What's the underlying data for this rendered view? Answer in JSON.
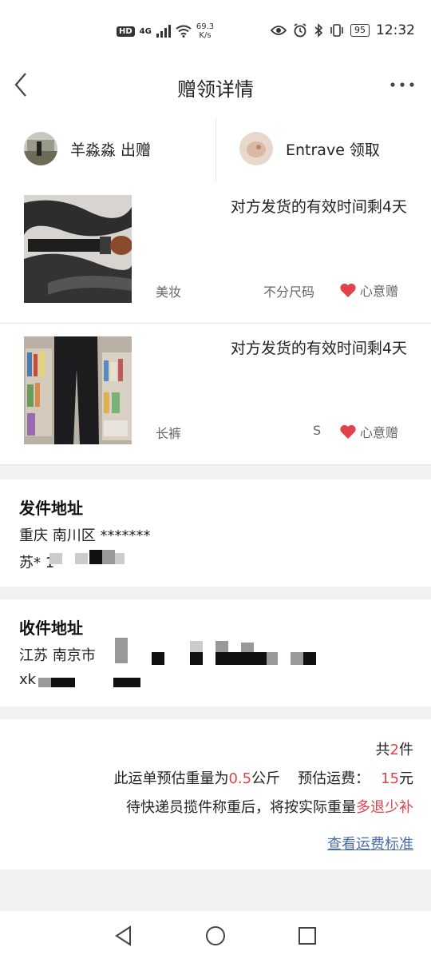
{
  "status_bar": {
    "hd": "HD",
    "network": "4G",
    "speed_value": "69.3",
    "speed_unit": "K/s",
    "battery": "95",
    "time": "12:32"
  },
  "nav": {
    "title": "赠领详情"
  },
  "parties": {
    "giver": "羊淼淼 出赠",
    "receiver": "Entrave 领取"
  },
  "items": [
    {
      "deadline": "对方发货的有效时间剩4天",
      "category": "美妆",
      "size": "不分尺码",
      "gift_label": "心意赠"
    },
    {
      "deadline": "对方发货的有效时间剩4天",
      "category": "长裤",
      "size": "S",
      "gift_label": "心意赠"
    }
  ],
  "sender_address": {
    "title": "发件地址",
    "line1": "重庆 南川区 *******",
    "line2": "苏* 1"
  },
  "receiver_address": {
    "title": "收件地址",
    "line1": "江苏 南京市",
    "line2": "xk"
  },
  "summary": {
    "total_prefix": "共",
    "total_count": "2",
    "total_suffix": "件",
    "weight_prefix": "此运单预估重量为",
    "weight_value": "0.5",
    "weight_unit": "公斤",
    "fee_prefix": "预估运费：",
    "fee_value": "15",
    "fee_unit": "元",
    "note_prefix": "待快递员揽件称重后，将按实际重量",
    "note_highlight": "多退少补",
    "fee_link": "查看运费标准"
  },
  "colors": {
    "accent_red": "#e0434b",
    "link_blue": "#4a6fa5"
  }
}
